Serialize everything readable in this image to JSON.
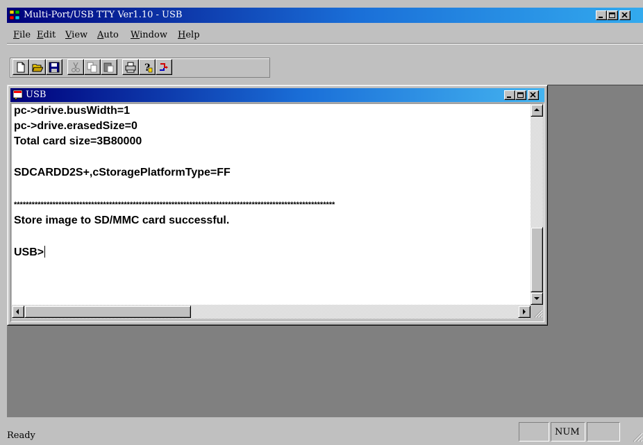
{
  "app": {
    "title": "Multi-Port/USB TTY Ver1.10 - USB"
  },
  "menu": [
    {
      "key": "F",
      "rest": "ile"
    },
    {
      "key": "E",
      "rest": "dit"
    },
    {
      "key": "V",
      "rest": "iew"
    },
    {
      "key": "A",
      "rest": "uto"
    },
    {
      "key": "W",
      "rest": "indow"
    },
    {
      "key": "H",
      "rest": "elp"
    }
  ],
  "toolbar": {
    "buttons": [
      "new-icon",
      "open-icon",
      "save-icon",
      "cut-icon",
      "copy-icon",
      "paste-icon",
      "print-icon",
      "help-icon",
      "connect-icon"
    ]
  },
  "child_window": {
    "title": "USB",
    "lines": [
      "pc->drive.busWidth=1",
      "pc->drive.erasedSize=0",
      "Total card size=3B80000",
      "",
      "SDCARDD2S+,cStoragePlatformType=FF",
      "",
      "************************************************************************************************************",
      "Store image to SD/MMC card successful.",
      "",
      "USB>"
    ]
  },
  "statusbar": {
    "text": "Ready",
    "num_indicator": "NUM"
  },
  "colors": {
    "title_gradient_start": "#00007b",
    "title_gradient_end": "#33aaee",
    "face": "#c0c0c0",
    "mdi_background": "#808080"
  }
}
